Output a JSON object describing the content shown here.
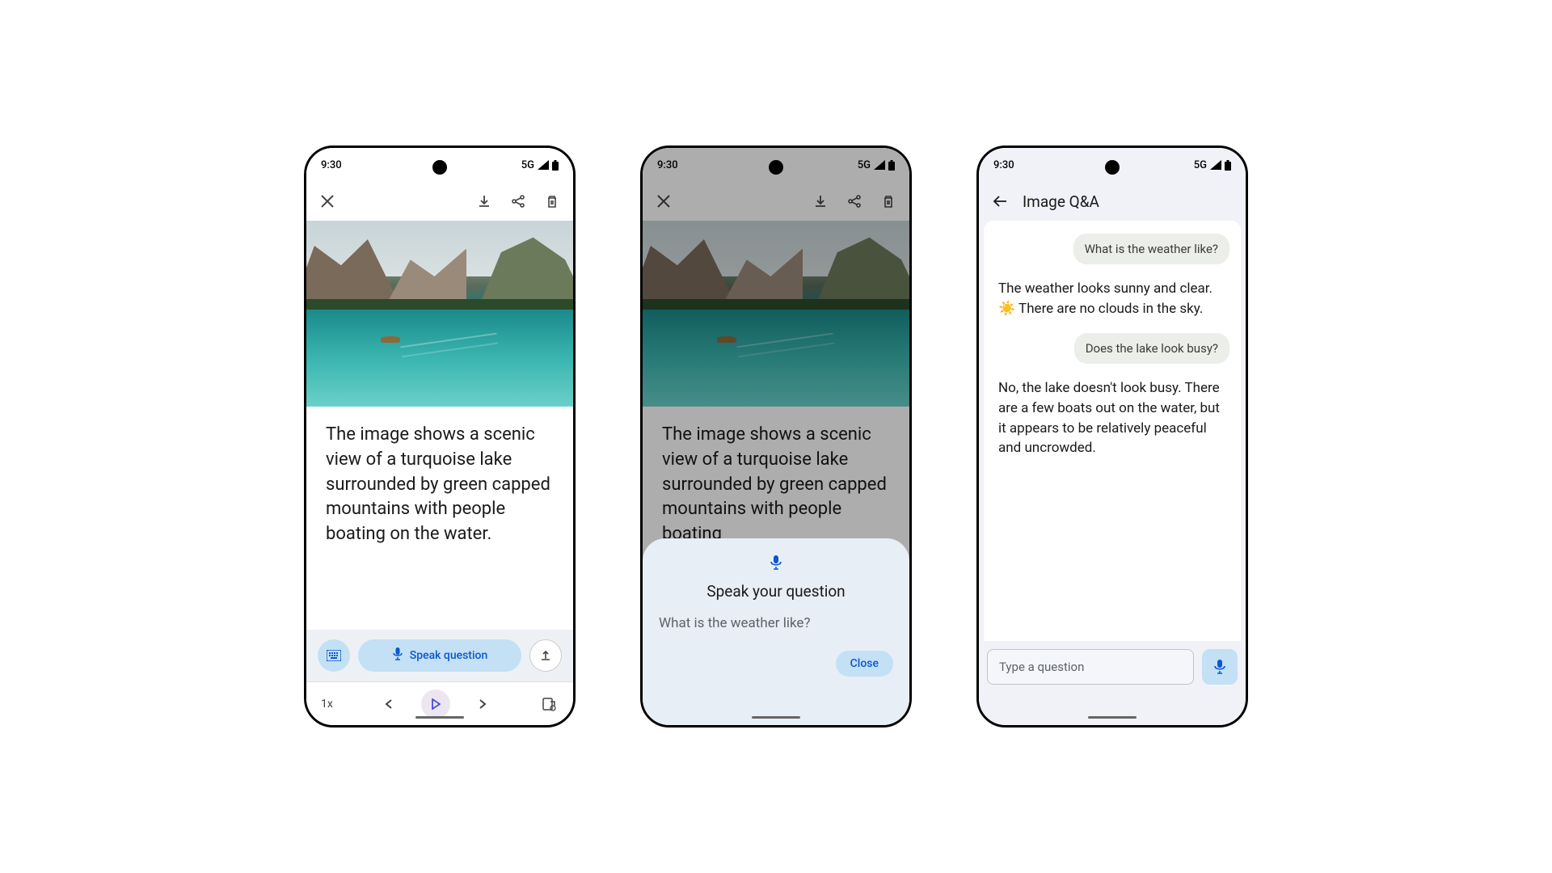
{
  "status": {
    "time": "9:30",
    "network": "5G"
  },
  "phone1": {
    "description": "The image shows a scenic view of a turquoise lake surrounded by green capped mountains with people boating on the water.",
    "speak_label": "Speak question",
    "speed_label": "1x"
  },
  "phone2": {
    "description": "The image shows a scenic view of a turquoise lake surrounded by green capped mountains with people boating",
    "sheet_title": "Speak your question",
    "transcript": "What is the weather like?",
    "close_label": "Close"
  },
  "phone3": {
    "title": "Image Q&A",
    "messages": [
      {
        "role": "user",
        "text": "What is the weather like?"
      },
      {
        "role": "assistant",
        "text": "The weather looks sunny and clear. ☀️ There are no clouds in the sky."
      },
      {
        "role": "user",
        "text": "Does the lake look busy?"
      },
      {
        "role": "assistant",
        "text": "No, the lake doesn't look busy. There are a few boats out on the water, but it appears to be relatively peaceful and uncrowded."
      }
    ],
    "input_placeholder": "Type a question"
  }
}
